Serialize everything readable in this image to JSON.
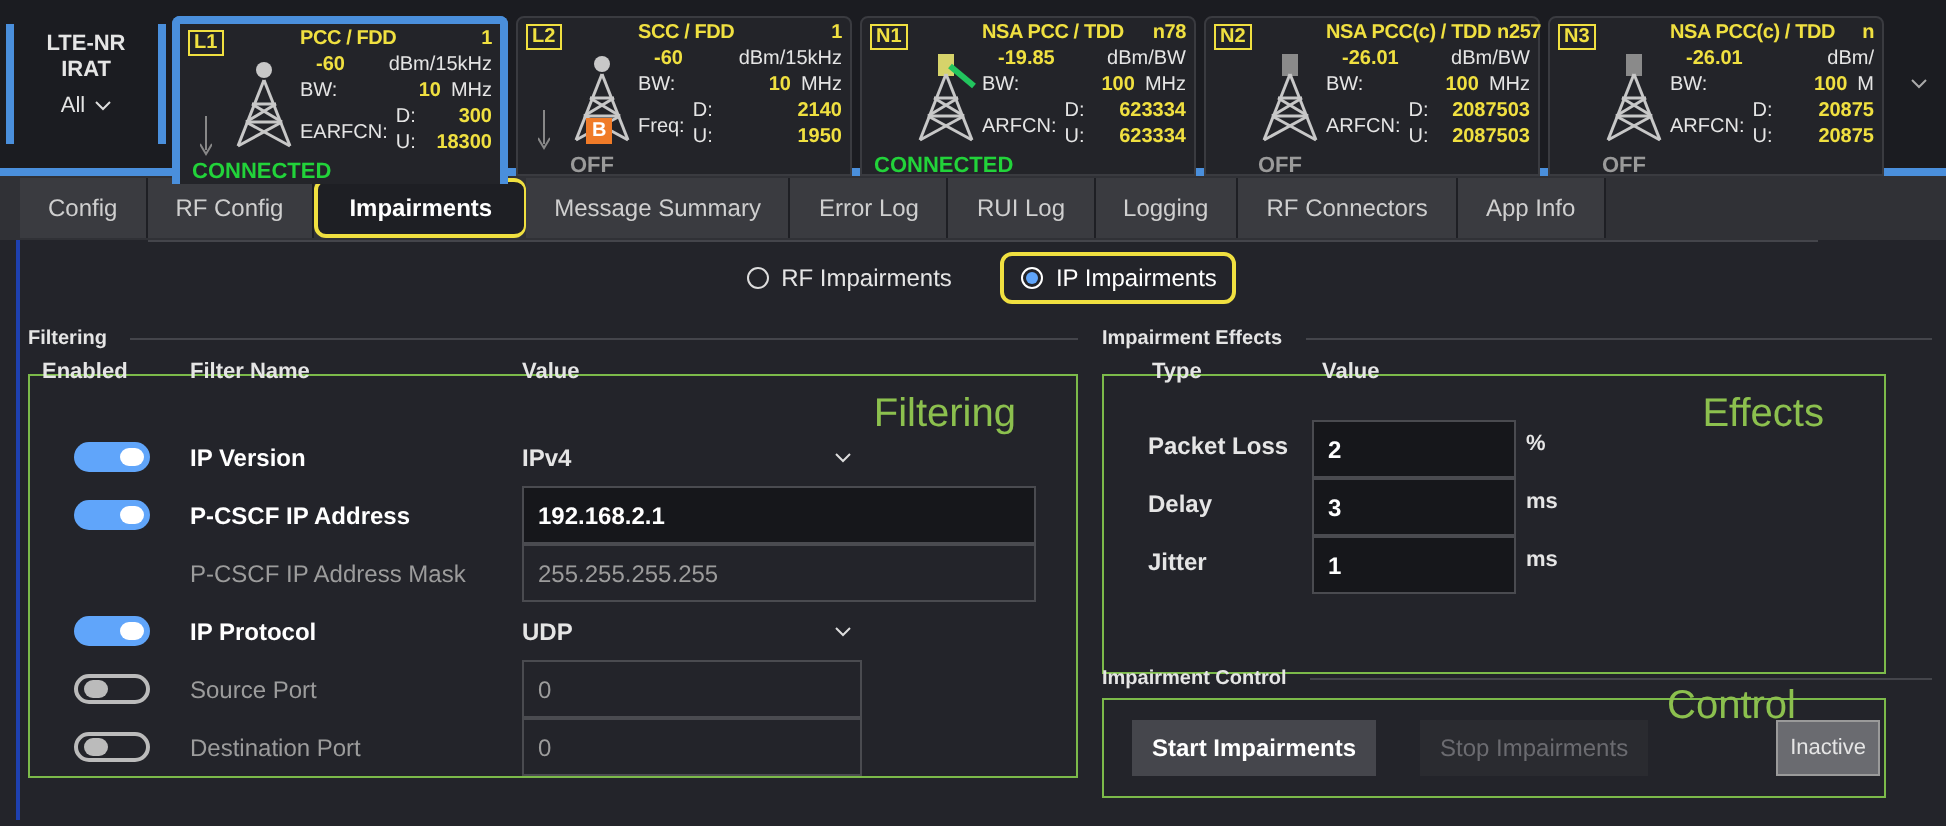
{
  "carrier_selector": {
    "title": "LTE-NR\nIRAT",
    "filter": "All"
  },
  "cells": [
    {
      "tag": "L1",
      "kind": "lte",
      "selected": true,
      "title": "PCC / FDD",
      "band": "1",
      "power": "-60",
      "power_unit": "dBm/15kHz",
      "bw_label": "BW:",
      "bw": "10",
      "bw_unit": "MHz",
      "freq_label": "EARFCN:",
      "d_label": "D:",
      "d": "300",
      "u_label": "U:",
      "u": "18300",
      "status": "CONNECTED",
      "connected": true
    },
    {
      "tag": "L2",
      "kind": "lte",
      "selected": false,
      "title": "SCC / FDD",
      "band": "1",
      "power": "-60",
      "power_unit": "dBm/15kHz",
      "bw_label": "BW:",
      "bw": "10",
      "bw_unit": "MHz",
      "freq_label": "Freq:",
      "d_label": "D:",
      "d": "2140",
      "u_label": "U:",
      "u": "1950",
      "status": "OFF",
      "connected": false,
      "badge": "B"
    },
    {
      "tag": "N1",
      "kind": "nr",
      "selected": false,
      "title": "NSA PCC / TDD",
      "band": "n78",
      "power": "-19.85",
      "power_unit": "dBm/BW",
      "bw_label": "BW:",
      "bw": "100",
      "bw_unit": "MHz",
      "freq_label": "ARFCN:",
      "d_label": "D:",
      "d": "623334",
      "u_label": "U:",
      "u": "623334",
      "status": "CONNECTED",
      "connected": true
    },
    {
      "tag": "N2",
      "kind": "nr",
      "selected": false,
      "title": "NSA PCC(c) / TDD",
      "band": "n257",
      "power": "-26.01",
      "power_unit": "dBm/BW",
      "bw_label": "BW:",
      "bw": "100",
      "bw_unit": "MHz",
      "freq_label": "ARFCN:",
      "d_label": "D:",
      "d": "2087503",
      "u_label": "U:",
      "u": "2087503",
      "status": "OFF",
      "connected": false
    },
    {
      "tag": "N3",
      "kind": "nr",
      "selected": false,
      "title": "NSA PCC(c) / TDD",
      "band": "n",
      "power": "-26.01",
      "power_unit": "dBm/",
      "bw_label": "BW:",
      "bw": "100",
      "bw_unit": "M",
      "freq_label": "ARFCN:",
      "d_label": "D:",
      "d": "20875",
      "u_label": "U:",
      "u": "20875",
      "status": "OFF",
      "connected": false
    }
  ],
  "tabs": [
    {
      "label": "Config",
      "selected": false
    },
    {
      "label": "RF Config",
      "selected": false
    },
    {
      "label": "Impairments",
      "selected": true
    },
    {
      "label": "Message Summary",
      "selected": false
    },
    {
      "label": "Error Log",
      "selected": false
    },
    {
      "label": "RUI Log",
      "selected": false
    },
    {
      "label": "Logging",
      "selected": false
    },
    {
      "label": "RF Connectors",
      "selected": false
    },
    {
      "label": "App Info",
      "selected": false
    }
  ],
  "mode_options": [
    {
      "label": "RF Impairments",
      "selected": false
    },
    {
      "label": "IP Impairments",
      "selected": true
    }
  ],
  "filtering": {
    "title": "Filtering",
    "annotation": "Filtering",
    "columns": [
      "Enabled",
      "Filter Name",
      "Value"
    ],
    "rows": [
      {
        "kind": "select",
        "enabled": true,
        "label": "IP Version",
        "value": "IPv4"
      },
      {
        "kind": "input",
        "enabled": true,
        "label": "P-CSCF IP Address",
        "value": "192.168.2.1"
      },
      {
        "kind": "input",
        "label": "P-CSCF IP Address Mask",
        "value": "255.255.255.255"
      },
      {
        "kind": "select",
        "enabled": true,
        "label": "IP Protocol",
        "value": "UDP"
      },
      {
        "kind": "input",
        "enabled": false,
        "label": "Source Port",
        "value": "0"
      },
      {
        "kind": "input",
        "enabled": false,
        "label": "Destination Port",
        "value": "0"
      }
    ]
  },
  "effects": {
    "title": "Impairment Effects",
    "annotation": "Effects",
    "columns": [
      "Type",
      "Value"
    ],
    "rows": [
      {
        "label": "Packet Loss",
        "value": "2",
        "unit": "%"
      },
      {
        "label": "Delay",
        "value": "3",
        "unit": "ms"
      },
      {
        "label": "Jitter",
        "value": "1",
        "unit": "ms"
      }
    ]
  },
  "control": {
    "title": "Impairment Control",
    "annotation": "Control",
    "buttons": [
      {
        "label": "Start Impairments",
        "disabled": false
      },
      {
        "label": "Stop Impairments",
        "disabled": true
      }
    ],
    "status": "Inactive"
  }
}
